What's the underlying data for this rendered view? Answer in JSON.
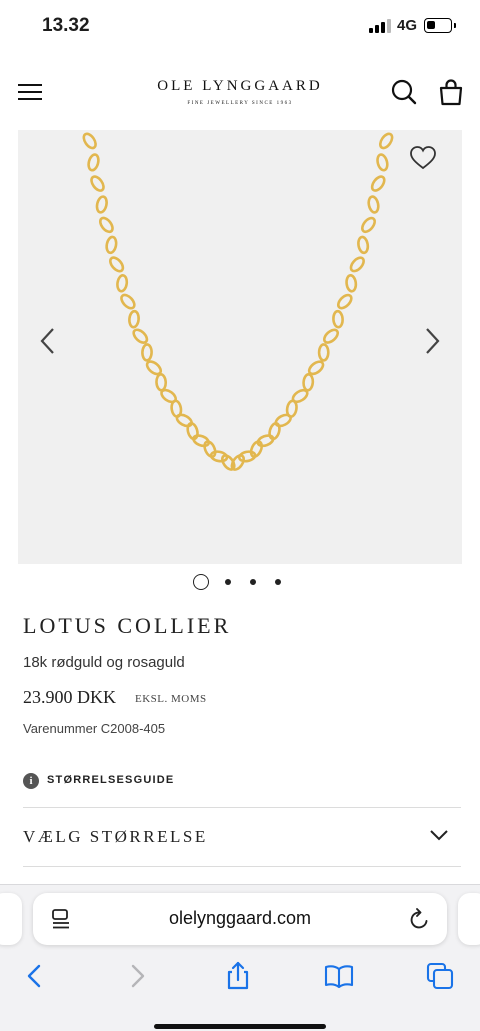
{
  "status_bar": {
    "time": "13.32",
    "network": "4G",
    "signal_bars": 3,
    "battery_level": 0.35
  },
  "header": {
    "brand": "OLE LYNGGAARD",
    "tagline": "FINE JEWELLERY SINCE 1963",
    "icons": [
      "menu-icon",
      "search-icon",
      "bag-icon"
    ]
  },
  "gallery": {
    "image_count": 4,
    "active_index": 0,
    "background": "#f0f0f0",
    "chain_color": "#e2b74f",
    "icons": [
      "heart-icon",
      "chevron-left-icon",
      "chevron-right-icon"
    ]
  },
  "product": {
    "title": "LOTUS COLLIER",
    "material": "18k rødguld og rosaguld",
    "price": "23.900 DKK",
    "price_note": "EKSL. MOMS",
    "sku": "Varenummer C2008-405"
  },
  "size_guide": {
    "label": "STØRRELSESGUIDE",
    "icon": "info-icon",
    "icon_glyph": "i"
  },
  "size_select": {
    "label": "VÆLG STØRRELSE",
    "icon": "chevron-down-icon"
  },
  "browser": {
    "url": "olelynggaard.com",
    "accent": "#1a73e8",
    "toolbar_icons": [
      "back-icon",
      "forward-icon",
      "share-icon",
      "bookmarks-icon",
      "tabs-icon"
    ]
  }
}
